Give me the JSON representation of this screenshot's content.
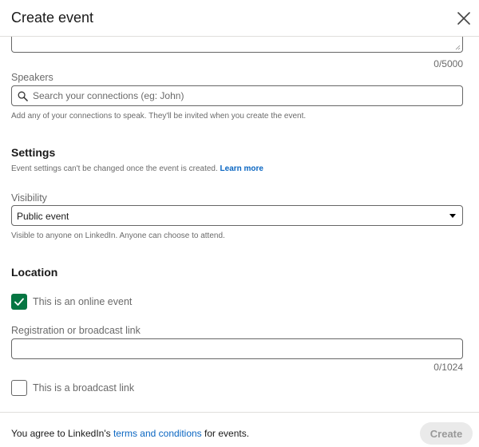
{
  "header": {
    "title": "Create event",
    "close_icon": "close-icon"
  },
  "description": {
    "counter": "0/5000"
  },
  "speakers": {
    "label": "Speakers",
    "placeholder": "Search your connections (eg: John)",
    "value": "",
    "helper": "Add any of your connections to speak. They'll be invited when you create the event."
  },
  "settings": {
    "title": "Settings",
    "helper": "Event settings can't be changed once the event is created.",
    "learn_more": "Learn more"
  },
  "visibility": {
    "label": "Visibility",
    "selected": "Public event",
    "helper": "Visible to anyone on LinkedIn. Anyone can choose to attend."
  },
  "location": {
    "title": "Location",
    "online_checkbox_label": "This is an online event",
    "online_checked": true,
    "link_label": "Registration or broadcast link",
    "link_value": "",
    "link_counter": "0/1024",
    "broadcast_checkbox_label": "This is a broadcast link",
    "broadcast_checked": false
  },
  "footer": {
    "agree_prefix": "You agree to LinkedIn's ",
    "terms_link": "terms and conditions",
    "agree_suffix": " for events.",
    "create_label": "Create"
  },
  "colors": {
    "accent_green": "#057642",
    "link_blue": "#0a66c2"
  }
}
